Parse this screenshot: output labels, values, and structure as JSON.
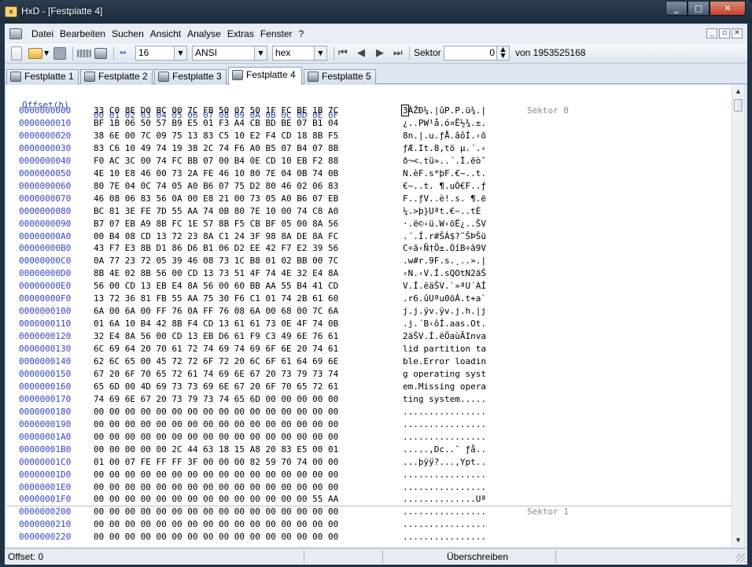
{
  "window": {
    "title": "HxD - [Festplatte 4]",
    "app_icon_text": "HxD"
  },
  "menu": {
    "items": [
      "Datei",
      "Bearbeiten",
      "Suchen",
      "Ansicht",
      "Analyse",
      "Extras",
      "Fenster",
      "?"
    ]
  },
  "toolbar": {
    "bytes_per_row": "16",
    "charset": "ANSI",
    "offset_base": "hex",
    "sector_label": "Sektor",
    "sector_value": "0",
    "sector_of": "von 1953525168"
  },
  "tabs": [
    {
      "label": "Festplatte 1",
      "active": false
    },
    {
      "label": "Festplatte 2",
      "active": false
    },
    {
      "label": "Festplatte 3",
      "active": false
    },
    {
      "label": "Festplatte 4",
      "active": true
    },
    {
      "label": "Festplatte 5",
      "active": false
    }
  ],
  "editor": {
    "header_offset": "Offset(h)",
    "header_columns": "00 01 02 03 04 05 06 07 08 09 0A 0B 0C 0D 0E 0F",
    "sector_labels": [
      "Sektor 0",
      "Sektor 1"
    ],
    "rows": [
      {
        "offset": "0000000000",
        "hex": "33 C0 8E D0 BC 00 7C FB 50 07 50 1F FC BE 1B 7C",
        "ascii": "3ÀŽÐ¼.|ûP.P.ü¾.|"
      },
      {
        "offset": "0000000010",
        "hex": "BF 1B 06 50 57 B9 E5 01 F3 A4 CB BD BE 07 B1 04",
        "ascii": "¿..PW¹å.ó¤Ë½¾.±."
      },
      {
        "offset": "0000000020",
        "hex": "38 6E 00 7C 09 75 13 83 C5 10 E2 F4 CD 18 8B F5",
        "ascii": "8n.|.u.ƒÅ.âôÍ.‹õ"
      },
      {
        "offset": "0000000030",
        "hex": "83 C6 10 49 74 19 38 2C 74 F6 A0 B5 07 B4 07 8B",
        "ascii": "ƒÆ.It.8,tö µ.´.‹"
      },
      {
        "offset": "0000000040",
        "hex": "F0 AC 3C 00 74 FC BB 07 00 B4 0E CD 10 EB F2 88",
        "ascii": "ð¬<.tü»..´.Í.ëòˆ"
      },
      {
        "offset": "0000000050",
        "hex": "4E 10 E8 46 00 73 2A FE 46 10 80 7E 04 0B 74 0B",
        "ascii": "N.èF.s*þF.€~..t."
      },
      {
        "offset": "0000000060",
        "hex": "80 7E 04 0C 74 05 A0 B6 07 75 D2 80 46 02 06 83",
        "ascii": "€~..t. ¶.uÒ€F..ƒ"
      },
      {
        "offset": "0000000070",
        "hex": "46 08 06 83 56 0A 00 E8 21 00 73 05 A0 B6 07 EB",
        "ascii": "F..ƒV..è!.s. ¶.ë"
      },
      {
        "offset": "0000000080",
        "hex": "BC 81 3E FE 7D 55 AA 74 0B 80 7E 10 00 74 C8 A0",
        "ascii": "¼.>þ}Uªt.€~..tÈ "
      },
      {
        "offset": "0000000090",
        "hex": "B7 07 EB A9 8B FC 1E 57 8B F5 CB BF 05 00 8A 56",
        "ascii": "·.ë©‹ü.W‹õË¿..ŠV"
      },
      {
        "offset": "00000000A0",
        "hex": "00 B4 08 CD 13 72 23 8A C1 24 3F 98 8A DE 8A FC",
        "ascii": ".´.Í.r#ŠÁ$?˜ŠÞŠü"
      },
      {
        "offset": "00000000B0",
        "hex": "43 F7 E3 8B D1 86 D6 B1 06 D2 EE 42 F7 E2 39 56",
        "ascii": "C÷ã‹Ñ†Ö±.ÒîB÷â9V"
      },
      {
        "offset": "00000000C0",
        "hex": "0A 77 23 72 05 39 46 08 73 1C B8 01 02 BB 00 7C",
        "ascii": ".w#r.9F.s.¸..».|"
      },
      {
        "offset": "00000000D0",
        "hex": "8B 4E 02 8B 56 00 CD 13 73 51 4F 74 4E 32 E4 8A",
        "ascii": "‹N.‹V.Í.sQOtN2äŠ"
      },
      {
        "offset": "00000000E0",
        "hex": "56 00 CD 13 EB E4 8A 56 00 60 BB AA 55 B4 41 CD",
        "ascii": "V.Í.ëäŠV.`»ªU´AÍ"
      },
      {
        "offset": "00000000F0",
        "hex": "13 72 36 81 FB 55 AA 75 30 F6 C1 01 74 2B 61 60",
        "ascii": ".r6.ûUªu0öÁ.t+a`"
      },
      {
        "offset": "0000000100",
        "hex": "6A 00 6A 00 FF 76 0A FF 76 08 6A 00 68 00 7C 6A",
        "ascii": "j.j.ÿv.ÿv.j.h.|j"
      },
      {
        "offset": "0000000110",
        "hex": "01 6A 10 B4 42 8B F4 CD 13 61 61 73 0E 4F 74 0B",
        "ascii": ".j.´B‹ôÍ.aas.Ot."
      },
      {
        "offset": "0000000120",
        "hex": "32 E4 8A 56 00 CD 13 EB D6 61 F9 C3 49 6E 76 61",
        "ascii": "2äŠV.Í.ëÖaùÃInva"
      },
      {
        "offset": "0000000130",
        "hex": "6C 69 64 20 70 61 72 74 69 74 69 6F 6E 20 74 61",
        "ascii": "lid partition ta"
      },
      {
        "offset": "0000000140",
        "hex": "62 6C 65 00 45 72 72 6F 72 20 6C 6F 61 64 69 6E",
        "ascii": "ble.Error loadin"
      },
      {
        "offset": "0000000150",
        "hex": "67 20 6F 70 65 72 61 74 69 6E 67 20 73 79 73 74",
        "ascii": "g operating syst"
      },
      {
        "offset": "0000000160",
        "hex": "65 6D 00 4D 69 73 73 69 6E 67 20 6F 70 65 72 61",
        "ascii": "em.Missing opera"
      },
      {
        "offset": "0000000170",
        "hex": "74 69 6E 67 20 73 79 73 74 65 6D 00 00 00 00 00",
        "ascii": "ting system....."
      },
      {
        "offset": "0000000180",
        "hex": "00 00 00 00 00 00 00 00 00 00 00 00 00 00 00 00",
        "ascii": "................"
      },
      {
        "offset": "0000000190",
        "hex": "00 00 00 00 00 00 00 00 00 00 00 00 00 00 00 00",
        "ascii": "................"
      },
      {
        "offset": "00000001A0",
        "hex": "00 00 00 00 00 00 00 00 00 00 00 00 00 00 00 00",
        "ascii": "................"
      },
      {
        "offset": "00000001B0",
        "hex": "00 00 00 00 00 2C 44 63 18 15 A8 20 83 E5 00 01",
        "ascii": ".....,Dc..¨ ƒå.."
      },
      {
        "offset": "00000001C0",
        "hex": "01 00 07 FE FF FF 3F 00 00 00 82 59 70 74 00 00",
        "ascii": "...þÿÿ?...‚Ypt.."
      },
      {
        "offset": "00000001D0",
        "hex": "00 00 00 00 00 00 00 00 00 00 00 00 00 00 00 00",
        "ascii": "................"
      },
      {
        "offset": "00000001E0",
        "hex": "00 00 00 00 00 00 00 00 00 00 00 00 00 00 00 00",
        "ascii": "................"
      },
      {
        "offset": "00000001F0",
        "hex": "00 00 00 00 00 00 00 00 00 00 00 00 00 00 55 AA",
        "ascii": "..............Uª"
      },
      {
        "offset": "0000000200",
        "hex": "00 00 00 00 00 00 00 00 00 00 00 00 00 00 00 00",
        "ascii": "................"
      },
      {
        "offset": "0000000210",
        "hex": "00 00 00 00 00 00 00 00 00 00 00 00 00 00 00 00",
        "ascii": "................"
      },
      {
        "offset": "0000000220",
        "hex": "00 00 00 00 00 00 00 00 00 00 00 00 00 00 00 00",
        "ascii": "................"
      }
    ]
  },
  "status": {
    "offset": "Offset: 0",
    "mode": "Überschreiben"
  },
  "icons": [
    "app-icon",
    "disk-icon",
    "new-file-icon",
    "open-folder-icon",
    "save-icon",
    "ram-icon",
    "disk-open-icon",
    "bytes-per-row-icon",
    "first-sector-icon",
    "previous-sector-icon",
    "next-sector-icon",
    "last-sector-icon"
  ]
}
